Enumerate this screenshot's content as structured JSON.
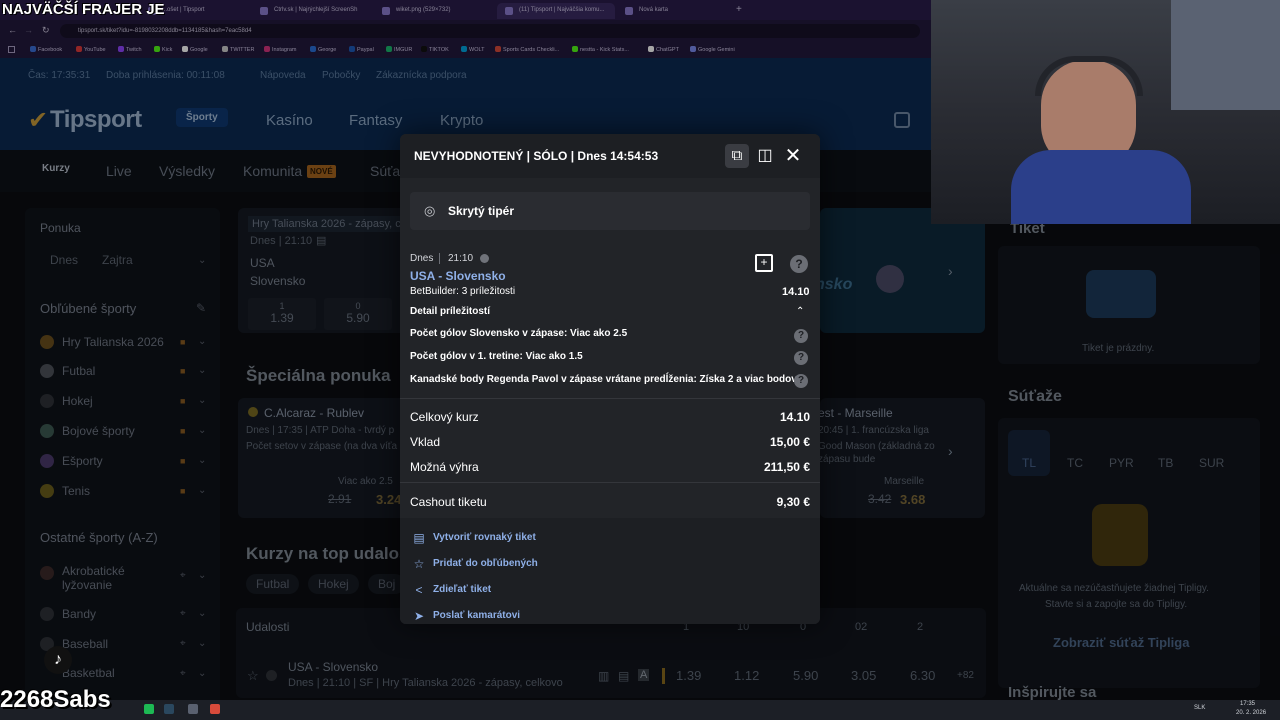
{
  "stream": {
    "overlay_title": "NAJVÄČŠÍ FRAJER JE",
    "username": "2268Sabs"
  },
  "browser": {
    "tabs": [
      {
        "label": "...ošet | Tipsport",
        "active": false
      },
      {
        "label": "Ctrlv.sk | Najrýchlejší ScreenSh",
        "active": false
      },
      {
        "label": "wiket.png (529×732)",
        "active": false
      },
      {
        "label": "(11) Tipsport | Najväčšia komu...",
        "active": true
      },
      {
        "label": "Nová karta",
        "active": false
      }
    ],
    "url": "tipsport.sk/tiket?idu=-8198032208ddb=1134185&hash=7eac58d4",
    "bookmarks": [
      "Facebook",
      "YouTube",
      "Twitch",
      "Kick",
      "Google",
      "TWITTER",
      "Instagram",
      "George",
      "Paypal",
      "IMGUR",
      "TIKTOK",
      "WOLT",
      "Sports Cards Checkli...",
      "nestta - Kick Stats...",
      "ChatGPT",
      "Google Gemini"
    ]
  },
  "site": {
    "info": {
      "time": "Čas: 17:35:31",
      "login": "Doba prihlásenia: 00:11:08",
      "help": "Nápoveda",
      "branches": "Pobočky",
      "support": "Zákaznícka podpora"
    },
    "logo": "Tipsport",
    "main_nav": [
      "Športy",
      "Kasíno",
      "Fantasy",
      "Krypto"
    ],
    "sub_nav": [
      "Kurzy",
      "Live",
      "Výsledky",
      "Komunita",
      "Súťa"
    ],
    "new_badge": "NOVÉ",
    "sidebar": {
      "offer_title": "Ponuka",
      "offer_tabs": [
        "Dnes",
        "Zajtra"
      ],
      "fav_title": "Obľúbené športy",
      "fav_items": [
        "Hry Talianska 2026",
        "Futbal",
        "Hokej",
        "Bojové športy",
        "Ešporty",
        "Tenis"
      ],
      "other_title": "Ostatné športy (A-Z)",
      "other_items": [
        "Akrobatické lyžovanie",
        "Bandy",
        "Baseball",
        "Basketbal"
      ]
    },
    "featured": {
      "league": "Hry Talianska 2026 - zápasy, ce",
      "time": "Dnes | 21:10",
      "team1": "USA",
      "team2": "Slovensko",
      "odds": [
        {
          "label": "1",
          "value": "1.39"
        },
        {
          "label": "0",
          "value": "5.90"
        }
      ],
      "banner_text": "nsko"
    },
    "special": {
      "title": "Špeciálna ponuka",
      "match1": {
        "name": "C.Alcaraz - Rublev",
        "info": "Dnes | 17:35 | ATP Doha - tvrdý p",
        "desc": "Počet setov v zápase (na dva víťa",
        "pick": "Viac ako 2.5",
        "old": "2.91",
        "new": "3.24"
      },
      "match2": {
        "name": "est - Marseille",
        "info": "20:45 | 1. francúzska liga",
        "desc1": "Good Mason (základná zo",
        "desc2": "zápasu bude",
        "pick": "Marseille",
        "old": "3.42",
        "new": "3.68"
      }
    },
    "top": {
      "title": "Kurzy na top udalos",
      "chips": [
        "Futbal",
        "Hokej",
        "Boj"
      ],
      "events_label": "Udalosti",
      "cols": [
        "1",
        "10",
        "0",
        "02",
        "2"
      ],
      "event": {
        "name": "USA - Slovensko",
        "info": "Dnes | 21:10 | SF | Hry Talianska 2026 - zápasy, celkovo",
        "odds": [
          "1.39",
          "1.12",
          "5.90",
          "3.05",
          "6.30"
        ],
        "more": "+82"
      }
    },
    "ticket": {
      "title": "Tiket",
      "empty": "Tiket je prázdny."
    },
    "contests": {
      "title": "Súťaže",
      "tabs": [
        "TL",
        "TC",
        "PYR",
        "TB",
        "SUR"
      ],
      "text1": "Aktuálne sa nezúčastňujete žiadnej Tipligy.",
      "text2": "Stavte si a zapojte sa do Tipligy.",
      "button": "Zobraziť súťaž Tipliga",
      "inspire": "Inšpirujte sa"
    }
  },
  "modal": {
    "title": "NEVYHODNOTENÝ | SÓLO | Dnes 14:54:53",
    "hidden_tipster": "Skrytý tipér",
    "match_day": "Dnes",
    "match_time": "21:10",
    "match_name": "USA - Slovensko",
    "betbuilder": "BetBuilder: 3 príležitosti",
    "betbuilder_odds": "14.10",
    "detail_label": "Detail príležitostí",
    "details": [
      "Počet gólov Slovensko v zápase: Viac ako 2.5",
      "Počet gólov v 1. tretine: Viac ako 1.5",
      "Kanadské body Regenda Pavol v zápase vrátane predĺženia: Získa 2 a viac bodov"
    ],
    "summary": [
      {
        "label": "Celkový kurz",
        "value": "14.10"
      },
      {
        "label": "Vklad",
        "value": "15,00 €"
      },
      {
        "label": "Možná výhra",
        "value": "211,50 €"
      }
    ],
    "cashout_label": "Cashout tiketu",
    "cashout_value": "9,30 €",
    "actions": [
      "Vytvoriť rovnaký tiket",
      "Pridať do obľúbených",
      "Zdieľať tiket",
      "Poslať kamarátovi"
    ]
  },
  "taskbar": {
    "lang": "SLK",
    "time": "17:35",
    "date": "20. 2. 2026"
  },
  "colors": {
    "brand_blue": "#0b2a52",
    "accent_link": "#8fb0e8",
    "modal_bg": "#222428"
  }
}
